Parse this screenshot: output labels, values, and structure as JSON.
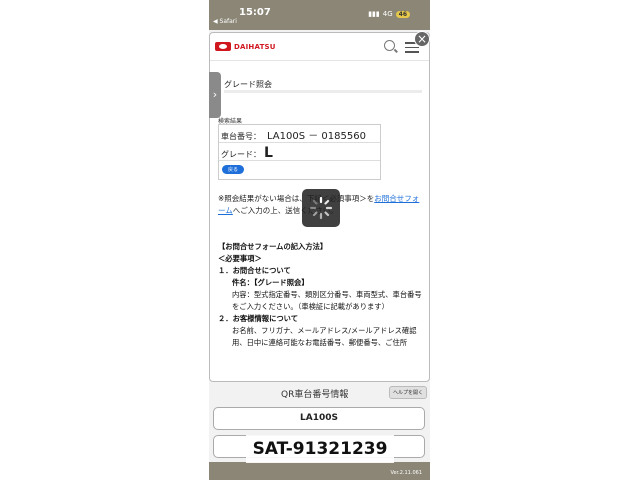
{
  "status_bar": {
    "time": "15:07",
    "back_app": "◀ Safari",
    "signal": "4G",
    "battery": "46"
  },
  "header": {
    "brand": "DAIHATSU"
  },
  "page": {
    "section_title": "グレード照会"
  },
  "result": {
    "label": "検索結果",
    "chassis_label": "車台番号：",
    "chassis_value": "LA100S － 0185560",
    "grade_label": "グレード：",
    "grade_value": "L",
    "back_button": "戻る"
  },
  "note": {
    "text_before": "※照会結果がない場合は、下記＜必須事項＞を",
    "link_text": "お問合せフォーム",
    "text_after": "へご入力の上、送信ください。"
  },
  "howto": {
    "heading": "【お問合せフォームの記入方法】",
    "required": "＜必要事項＞",
    "item1_title": "１．お問合せについて",
    "item1_subject": "件名：【グレード照会】",
    "item1_content": "内容：型式指定番号、類別区分番号、車両型式、車台番号　をご入力ください。（車検証に記載があります）",
    "item2_title": "２．お客様情報について",
    "item2_content": "お名前、フリガナ、メールアドレス/メールアドレス確認用、日中に連絡可能なお電話番号、郵便番号、ご住所"
  },
  "qr": {
    "title": "QR車台番号情報",
    "help_button": "ヘルプを開く",
    "model_button": "LA100S"
  },
  "footer": {
    "version": "Ver.2.11.061"
  },
  "overlay": {
    "label": "SAT-91321239"
  },
  "icons": {
    "search": "search-icon",
    "menu": "menu-icon",
    "close": "close-icon",
    "side": "chevron-right-icon",
    "spinner": "loading-spinner-icon"
  }
}
